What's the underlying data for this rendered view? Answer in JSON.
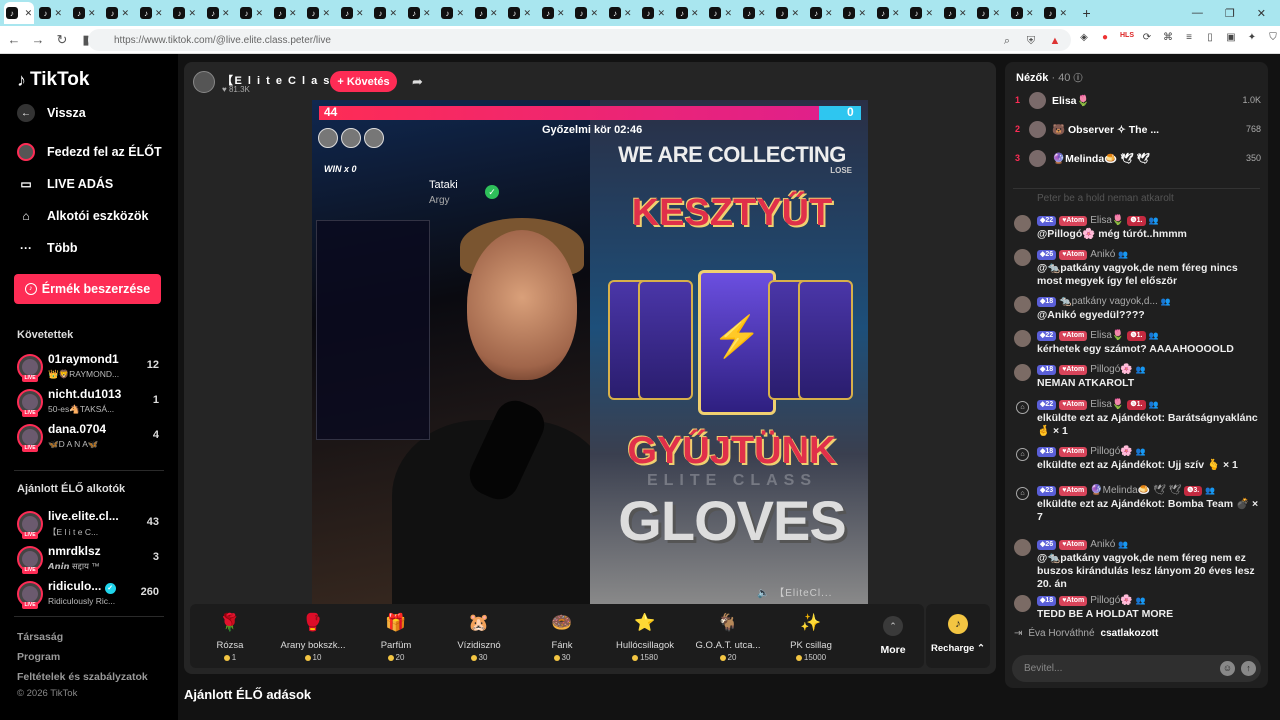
{
  "browser": {
    "url": "https://www.tiktok.com/@live.elite.class.peter/live",
    "tab_count": 32
  },
  "sidebar": {
    "logo": "TikTok",
    "back": "Vissza",
    "nav": [
      {
        "label": "Fedezd fel az ÉLŐT",
        "icon": "live-avatar-icon"
      },
      {
        "label": "LIVE ADÁS",
        "icon": "camera-icon"
      },
      {
        "label": "Alkotói eszközök",
        "icon": "home-plus-icon"
      },
      {
        "label": "Több",
        "icon": "more-icon"
      }
    ],
    "coin_button": "Érmék beszerzése",
    "following_title": "Követettek",
    "following": [
      {
        "name": "01raymond1",
        "sub": "👑🦁RAYMOND...",
        "count": "12"
      },
      {
        "name": "nicht.du1013",
        "sub": "50-es🐴TAKSÁ...",
        "count": "1"
      },
      {
        "name": "dana.0704",
        "sub": "🦋D A N A🦋",
        "count": "4"
      }
    ],
    "recommended_title": "Ajánlott ÉLŐ alkotók",
    "recommended": [
      {
        "name": "live.elite.cl...",
        "sub": "【E l i t e C...",
        "count": "43"
      },
      {
        "name": "nmrdklsz",
        "sub": "𝘼𝙣𝙞𝙣 सद्दाय ™",
        "count": "3"
      },
      {
        "name": "ridiculo...",
        "sub": "Ridiculously Ric...",
        "count": "260"
      }
    ],
    "footer_links": [
      "Társaság",
      "Program",
      "Feltételek és szabályzatok"
    ],
    "copyright": "© 2026 TikTok"
  },
  "stream": {
    "host_name": "【E l i t e C l a s s ...",
    "host_likes": "81.3K",
    "follow_label": "+ Követés",
    "score_left": "44",
    "score_right": "0",
    "battle_timer": "Győzelmi kör 02:46",
    "collecting_text": "WE ARE COLLECTING",
    "lose_label": "LOSE",
    "headline_1": "KESZTYŰT",
    "headline_2": "GYŰJTÜNK",
    "headline_3": "GLOVES",
    "faint_brand": "ELITE CLASS",
    "win_label": "WIN x 0",
    "guest_name": "Tataki",
    "guest_sub": "Argy",
    "watermark": "【EliteCl..."
  },
  "gifts": [
    {
      "name": "Rózsa",
      "price": "1",
      "icon": "rose-icon",
      "glyph": "🌹"
    },
    {
      "name": "Arany bokszk...",
      "price": "10",
      "icon": "gold-glove-icon",
      "glyph": "🥊"
    },
    {
      "name": "Parfüm",
      "price": "20",
      "icon": "perfume-icon",
      "glyph": "🎁"
    },
    {
      "name": "Vízidisznó",
      "price": "30",
      "icon": "capybara-icon",
      "glyph": "🐹"
    },
    {
      "name": "Fánk",
      "price": "30",
      "icon": "donut-icon",
      "glyph": "🍩"
    },
    {
      "name": "Hullócsillagok",
      "price": "1580",
      "icon": "shooting-star-icon",
      "glyph": "⭐"
    },
    {
      "name": "G.O.A.T. utca...",
      "price": "20",
      "icon": "goat-icon",
      "glyph": "🐐"
    },
    {
      "name": "PK csillag",
      "price": "15000",
      "icon": "pk-star-icon",
      "glyph": "✨"
    }
  ],
  "more_label": "More",
  "recharge_label": "Recharge",
  "recommended_live_title": "Ajánlott ÉLŐ adások",
  "chat": {
    "viewers_title": "Nézők",
    "viewers_count": "· 40",
    "top": [
      {
        "rank": "1",
        "name": "Elisa🌷",
        "score": "1.0K"
      },
      {
        "rank": "2",
        "name": "🐻 Observer ✧ The ...",
        "score": "768"
      },
      {
        "rank": "3",
        "name": "🔮Melinda🍮 🕊 🕊",
        "score": "350"
      }
    ],
    "faded_line": "Peter be a hold neman atkarolt",
    "messages": [
      {
        "level": "22",
        "fan": "Atom",
        "user": "Elisa🌷",
        "rank_badge": "1.",
        "text": "@Pillogó🌸 még túrót..hmmm"
      },
      {
        "level": "26",
        "fan": "Atom",
        "user": "Anikó",
        "rank_badge": "",
        "text": "@🐀patkány vagyok,de nem féreg nincs most megyek így fel először"
      },
      {
        "level": "18",
        "fan": "",
        "user": "🐀patkány vagyok,d...",
        "rank_badge": "",
        "text": "@Anikó egyedül????"
      },
      {
        "level": "22",
        "fan": "Atom",
        "user": "Elisa🌷",
        "rank_badge": "1.",
        "text": "kérhetek egy számot? AAAAHOOOOLD"
      },
      {
        "level": "18",
        "fan": "Atom",
        "user": "Pillogó🌸",
        "rank_badge": "",
        "text": "NEMAN ATKAROLT"
      },
      {
        "level": "22",
        "fan": "Atom",
        "user": "Elisa🌷",
        "rank_badge": "1.",
        "text": "elküldte ezt az Ajándékot: Barátságnyaklánc 🤞 × 1"
      },
      {
        "level": "18",
        "fan": "Atom",
        "user": "Pillogó🌸",
        "rank_badge": "",
        "text": "elküldte ezt az Ajándékot: Ujj szív 🫰 × 1"
      },
      {
        "level": "23",
        "fan": "Atom",
        "user": "🔮Melinda🍮 🕊 🕊",
        "rank_badge": "3.",
        "text": "elküldte ezt az Ajándékot: Bomba Team 💣 × 7"
      },
      {
        "level": "26",
        "fan": "Atom",
        "user": "Anikó",
        "rank_badge": "",
        "text": "@🐀patkány vagyok,de nem féreg nem ez buszos kirándulás lesz lányom 20 éves lesz 20. án"
      },
      {
        "level": "18",
        "fan": "Atom",
        "user": "Pillogó🌸",
        "rank_badge": "",
        "text": "TEDD BE A HOLDAT MORE"
      }
    ],
    "joined_name": "Éva Horváthné",
    "joined_text": "csatlakozott",
    "input_placeholder": "Bevitel..."
  }
}
